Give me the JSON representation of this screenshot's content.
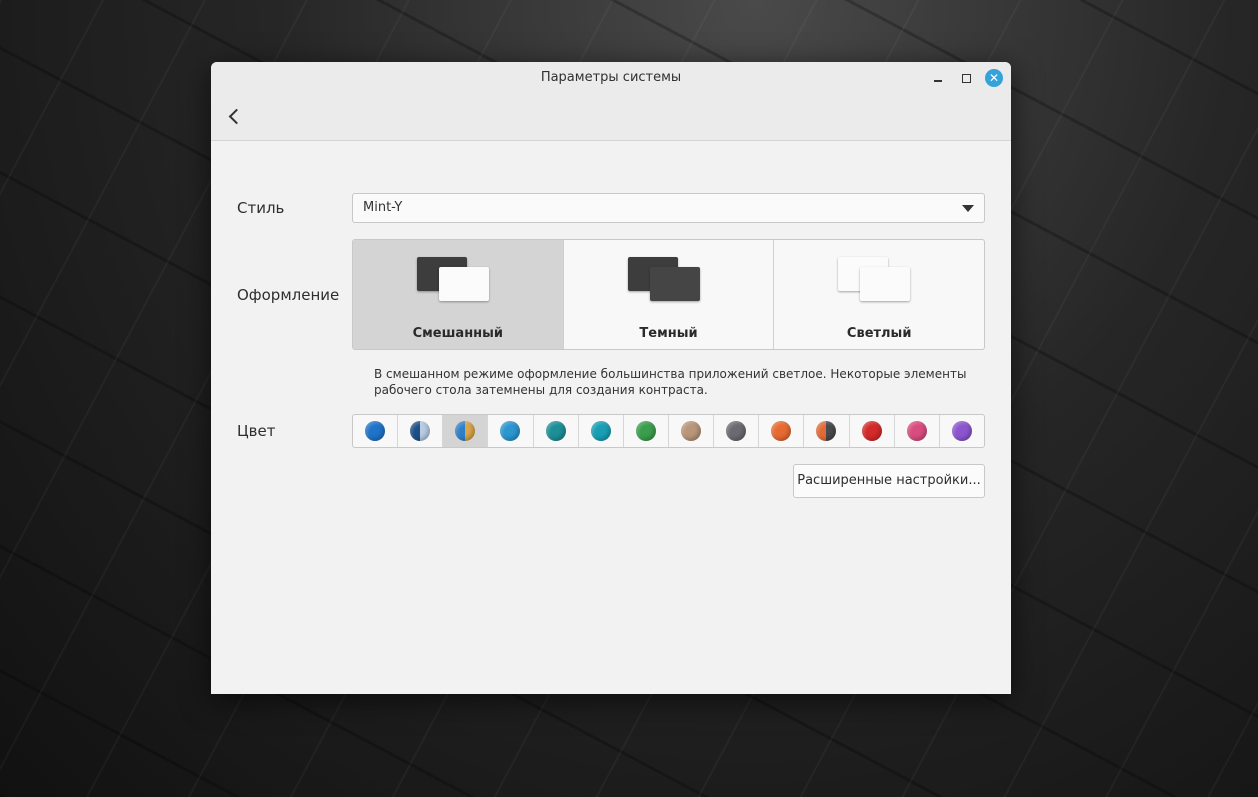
{
  "window": {
    "title": "Параметры системы"
  },
  "labels": {
    "style": "Стиль",
    "theme": "Оформление",
    "color": "Цвет"
  },
  "style_select": {
    "value": "Mint-Y"
  },
  "themes": [
    {
      "name": "Смешанный",
      "selected": true
    },
    {
      "name": "Темный",
      "selected": false
    },
    {
      "name": "Светлый",
      "selected": false
    }
  ],
  "description": "В смешанном режиме оформление большинства приложений светлое. Некоторые элементы рабочего стола затемнены для создания контраста.",
  "colors": [
    {
      "name": "blue",
      "fill": "#1f73c9"
    },
    {
      "name": "blue-light-split",
      "fill": "linear-gradient(90deg,#1c4f86 50%,#b8cce2 50%)"
    },
    {
      "name": "blue-sand-split",
      "fill": "linear-gradient(90deg,#2f7fc8 50%,#d9a64a 50%)",
      "selected": true
    },
    {
      "name": "aqua",
      "fill": "#2b96cf"
    },
    {
      "name": "teal",
      "fill": "#1d8f97"
    },
    {
      "name": "cyan",
      "fill": "#189fb5"
    },
    {
      "name": "green",
      "fill": "#3a9e4d"
    },
    {
      "name": "sand",
      "fill": "#b8967a"
    },
    {
      "name": "grey",
      "fill": "#6a6a70"
    },
    {
      "name": "orange",
      "fill": "#e76a32"
    },
    {
      "name": "orange-grey-split",
      "fill": "linear-gradient(90deg,#e26a36 50%,#4a4a4f 50%)"
    },
    {
      "name": "red",
      "fill": "#d42a2a"
    },
    {
      "name": "pink",
      "fill": "#d94c80"
    },
    {
      "name": "purple",
      "fill": "#8c55cf"
    }
  ],
  "advanced_button": "Расширенные настройки..."
}
